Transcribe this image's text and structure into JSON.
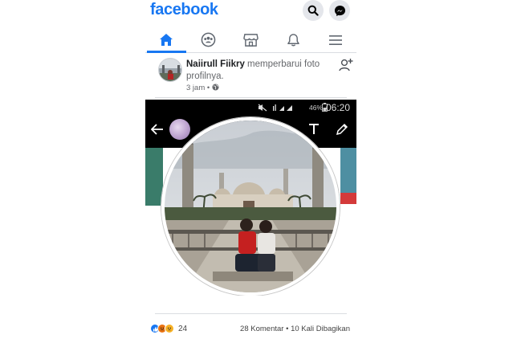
{
  "header": {
    "logo": "facebook",
    "search_icon": "search-icon",
    "messenger_icon": "messenger-icon"
  },
  "nav": {
    "tabs": [
      {
        "icon": "home-icon",
        "active": true
      },
      {
        "icon": "groups-icon",
        "active": false
      },
      {
        "icon": "marketplace-icon",
        "active": false
      },
      {
        "icon": "bell-icon",
        "active": false
      },
      {
        "icon": "menu-icon",
        "active": false
      }
    ],
    "accent": "#1877f2"
  },
  "post": {
    "author": "Naiirull Fiikry",
    "action": " memperbarui foto profilnya.",
    "time": "3 jam",
    "separator": "•",
    "privacy_icon": "globe-icon",
    "add_friend_icon": "add-friend-icon"
  },
  "photo": {
    "status_time": "06:20",
    "battery": "46%"
  },
  "footer": {
    "reactions": [
      "like",
      "angry",
      "sad"
    ],
    "reaction_count": "24",
    "comments": "28 Komentar",
    "dot": "•",
    "shares": "10 Kali Dibagikan"
  }
}
